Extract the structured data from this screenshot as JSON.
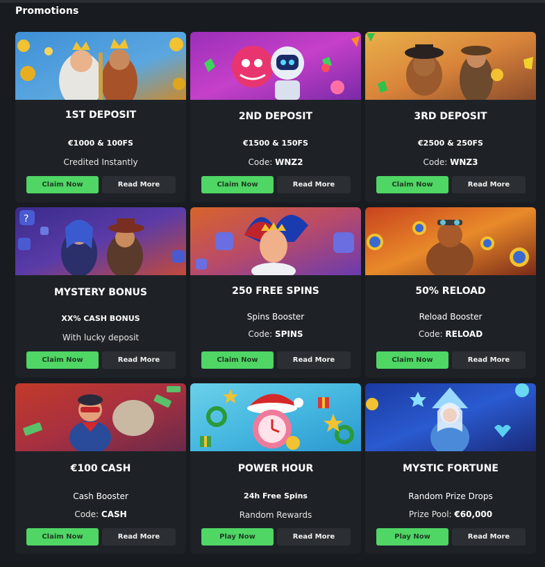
{
  "page": {
    "title": "Promotions"
  },
  "colors": {
    "accent": "#4fd665",
    "card": "#1e2227",
    "background": "#181b1f"
  },
  "cards": [
    {
      "title": "1ST DEPOSIT",
      "line1": "€1000 & 100FS",
      "line2_text": "Credited Instantly",
      "line2_bold": "",
      "primary": "Claim Now",
      "secondary": "Read More",
      "banner": "zeus-and-king-art"
    },
    {
      "title": "2ND DEPOSIT",
      "line1": "€1500 & 150FS",
      "line2_text": "Code: ",
      "line2_bold": "WNZ2",
      "primary": "Claim Now",
      "secondary": "Read More",
      "banner": "fruit-monster-and-robot-art"
    },
    {
      "title": "3RD DEPOSIT",
      "line1": "€2500 & 250FS",
      "line2_text": "Code: ",
      "line2_bold": "WNZ3",
      "primary": "Claim Now",
      "secondary": "Read More",
      "banner": "pirate-dog-and-explorer-art"
    },
    {
      "title": "MYSTERY BONUS",
      "line1": "XX% CASH BONUS",
      "line2_text": "With lucky deposit",
      "line2_bold": "",
      "primary": "Claim Now",
      "secondary": "Read More",
      "banner": "mystery-heroes-art"
    },
    {
      "title": "250 FREE SPINS",
      "line1": "Spins Booster",
      "line2_text": "Code: ",
      "line2_bold": "SPINS",
      "primary": "Claim Now",
      "secondary": "Read More",
      "banner": "jester-art"
    },
    {
      "title": "50% RELOAD",
      "line1": "Reload Booster",
      "line2_text": "Code: ",
      "line2_bold": "RELOAD",
      "primary": "Claim Now",
      "secondary": "Read More",
      "banner": "fire-warrior-art"
    },
    {
      "title": "€100 CASH",
      "line1": "Cash Booster",
      "line2_text": "Code: ",
      "line2_bold": "CASH",
      "primary": "Claim Now",
      "secondary": "Read More",
      "banner": "robber-art"
    },
    {
      "title": "POWER HOUR",
      "line1": "24h Free Spins",
      "line2_text": "Random Rewards",
      "line2_bold": "",
      "primary": "Play Now",
      "secondary": "Read More",
      "banner": "christmas-clock-art"
    },
    {
      "title": "MYSTIC FORTUNE",
      "line1": "Random Prize Drops",
      "line2_text": "Prize Pool: ",
      "line2_bold": "€60,000",
      "primary": "Play Now",
      "secondary": "Read More",
      "banner": "ice-queen-art"
    }
  ]
}
